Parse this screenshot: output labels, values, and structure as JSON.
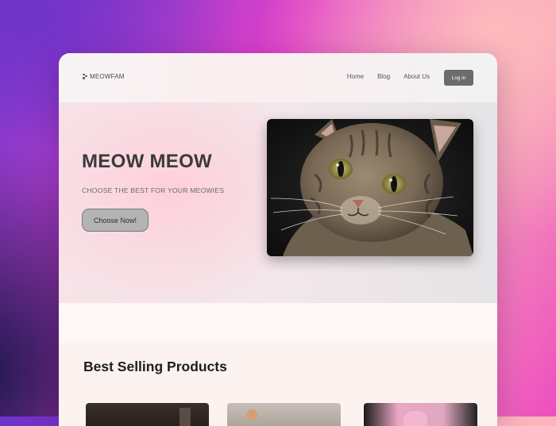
{
  "navbar": {
    "logo_text": "MEOWFAM",
    "links": [
      {
        "label": "Home"
      },
      {
        "label": "Blog"
      },
      {
        "label": "About Us"
      }
    ],
    "login_label": "Log in"
  },
  "hero": {
    "title": "MEOW MEOW",
    "subtitle": "CHOOSE THE BEST FOR YOUR MEOWIES",
    "cta_label": "Choose Now!",
    "image_icon": "tabby-kitten-photo"
  },
  "products": {
    "title": "Best Selling Products",
    "cards": [
      {
        "image_icon": "product-photo-dark"
      },
      {
        "image_icon": "product-photo-cat"
      },
      {
        "image_icon": "product-photo-pink"
      }
    ]
  }
}
